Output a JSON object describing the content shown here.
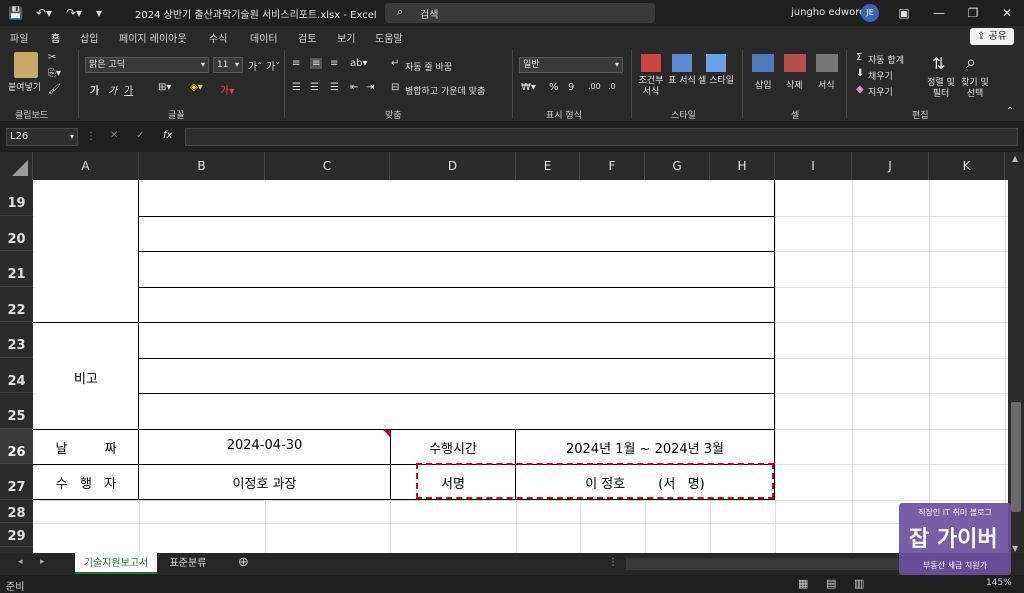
{
  "title_bar": {
    "document_title": "2024 상반기 출산과학기술원 서비스리포트.xlsx  -  Excel",
    "search_placeholder": "검색",
    "user_name": "jungho edword",
    "user_initials": "JE"
  },
  "ribbon_tabs": [
    "파일",
    "홈",
    "삽입",
    "페이지 레이아웃",
    "수식",
    "데이터",
    "검토",
    "보기",
    "도움말"
  ],
  "active_tab": "홈",
  "share_label": "공유",
  "ribbon": {
    "clipboard": {
      "paste_label": "붙여넣기",
      "group_label": "클립보드"
    },
    "font": {
      "font_name": "맑은 고딕",
      "font_size": "11",
      "bold": "가",
      "italic": "가",
      "underline": "가",
      "group_label": "글꼴"
    },
    "alignment": {
      "wrap_text": "자동 줄 바꿈",
      "merge_center": "병합하고 가운데 맞춤",
      "group_label": "맞춤"
    },
    "number": {
      "format": "일반",
      "group_label": "표시 형식"
    },
    "styles": {
      "conditional": "조건부 서식",
      "table": "표 서식",
      "cell_style": "셀 스타일",
      "group_label": "스타일"
    },
    "cells": {
      "insert": "삽입",
      "delete": "삭제",
      "format": "서식",
      "group_label": "셀"
    },
    "editing": {
      "autosum": "자동 합계",
      "fill": "채우기",
      "clear": "지우기",
      "sort_filter": "정렬 및 필터",
      "find_select": "찾기 및 선택",
      "group_label": "편집"
    }
  },
  "formula_bar": {
    "name_box": "L26",
    "formula": ""
  },
  "columns": [
    "A",
    "B",
    "C",
    "D",
    "E",
    "F",
    "G",
    "H",
    "I",
    "J",
    "K"
  ],
  "rows": [
    "19",
    "20",
    "21",
    "22",
    "23",
    "24",
    "25",
    "26",
    "27",
    "28",
    "29"
  ],
  "selected_row": "26",
  "cells": {
    "bigo": "비고",
    "date_label": "날         짜",
    "date_value": "2024-04-30",
    "perform_time_label": "수행시간",
    "perform_time_value": "2024년 1월 ~ 2024년 3월",
    "performer_label": "수   행   자",
    "performer_value": "이정호 과장",
    "sign_label": "서명",
    "sign_value": "이 정호        (서   명)"
  },
  "sheet_tabs": [
    "기술지원보고서",
    "표준분류"
  ],
  "active_sheet": "기술지원보고서",
  "status": {
    "ready": "준비",
    "zoom": "145%"
  },
  "watermark": {
    "line1": "직장인 IT 취미 블로그",
    "line2": "잡 가이버",
    "line3": "부동산 세금 지원가"
  }
}
